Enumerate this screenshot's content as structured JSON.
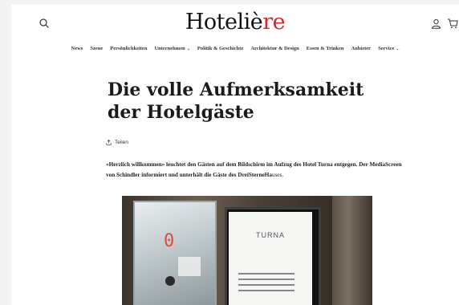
{
  "header": {
    "logo_main": "Hoteliè",
    "logo_accent": "re",
    "brand_color": "#d8262b",
    "icons": [
      "search-icon",
      "account-icon",
      "cart-icon"
    ]
  },
  "nav": {
    "items": [
      {
        "label": "News"
      },
      {
        "label": "Szene"
      },
      {
        "label": "Persönlichkeiten"
      },
      {
        "label": "Unternehmen",
        "dropdown": true
      },
      {
        "label": "Politik & Geschichte"
      },
      {
        "label": "Architektur & Design"
      },
      {
        "label": "Essen & Trinken"
      },
      {
        "label": "Anbieter"
      },
      {
        "label": "Service",
        "dropdown": true
      }
    ],
    "chevron": "⌄"
  },
  "article": {
    "title": "Die volle Aufmerksamkeit der Hotelgäste",
    "share_label": "Teilen",
    "lead_bold": "«Herzlich willkommen» leuchtet den Gästen auf dem Bildschirm im Aufzug des Hotel Turna entgegen. Der MediaScreen von Schindler informiert und unterhält die Gäste des DreiSterneHa",
    "lead_rest": "uses."
  },
  "photo": {
    "floor_display": "0",
    "screen_brand": "TURNA"
  }
}
